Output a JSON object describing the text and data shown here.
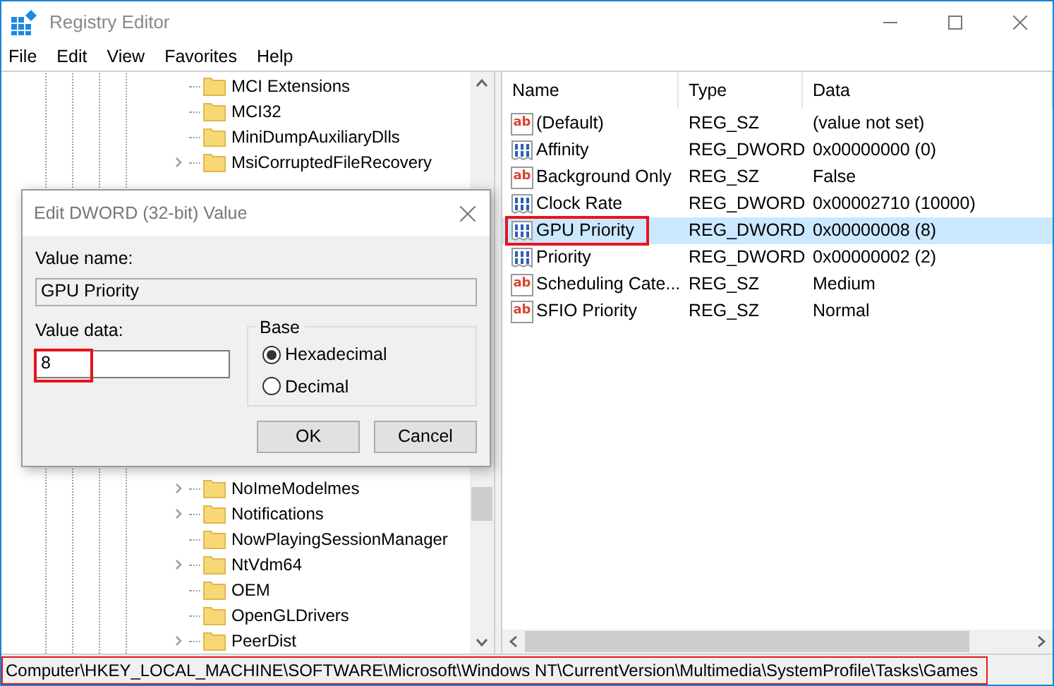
{
  "window": {
    "title": "Registry Editor"
  },
  "menu": [
    "File",
    "Edit",
    "View",
    "Favorites",
    "Help"
  ],
  "tree": {
    "upper": [
      {
        "label": "MCI Extensions",
        "has_children": false
      },
      {
        "label": "MCI32",
        "has_children": false
      },
      {
        "label": "MiniDumpAuxiliaryDlls",
        "has_children": false
      },
      {
        "label": "MsiCorruptedFileRecovery",
        "has_children": true,
        "expanded": false
      }
    ],
    "lower": [
      {
        "label": "NoImeModelmes",
        "has_children": true,
        "expanded": false
      },
      {
        "label": "Notifications",
        "has_children": true,
        "expanded": false
      },
      {
        "label": "NowPlayingSessionManager",
        "has_children": false
      },
      {
        "label": "NtVdm64",
        "has_children": true,
        "expanded": false
      },
      {
        "label": "OEM",
        "has_children": false
      },
      {
        "label": "OpenGLDrivers",
        "has_children": false
      },
      {
        "label": "PeerDist",
        "has_children": true,
        "expanded": false
      }
    ]
  },
  "values": {
    "columns": [
      "Name",
      "Type",
      "Data"
    ],
    "rows": [
      {
        "kind": "sz",
        "icon_label": "ab",
        "name": "(Default)",
        "type": "REG_SZ",
        "data": "(value not set)",
        "selected": false,
        "highlighted": false
      },
      {
        "kind": "dword",
        "name": "Affinity",
        "type": "REG_DWORD",
        "data": "0x00000000 (0)",
        "selected": false,
        "highlighted": false
      },
      {
        "kind": "sz",
        "icon_label": "ab",
        "name": "Background Only",
        "type": "REG_SZ",
        "data": "False",
        "selected": false,
        "highlighted": false
      },
      {
        "kind": "dword",
        "name": "Clock Rate",
        "type": "REG_DWORD",
        "data": "0x00002710 (10000)",
        "selected": false,
        "highlighted": false
      },
      {
        "kind": "dword",
        "name": "GPU Priority",
        "type": "REG_DWORD",
        "data": "0x00000008 (8)",
        "selected": true,
        "highlighted": true
      },
      {
        "kind": "dword",
        "name": "Priority",
        "type": "REG_DWORD",
        "data": "0x00000002 (2)",
        "selected": false,
        "highlighted": false
      },
      {
        "kind": "sz",
        "icon_label": "ab",
        "name": "Scheduling Cate...",
        "type": "REG_SZ",
        "data": "Medium",
        "selected": false,
        "highlighted": false
      },
      {
        "kind": "sz",
        "icon_label": "ab",
        "name": "SFIO Priority",
        "type": "REG_SZ",
        "data": "Normal",
        "selected": false,
        "highlighted": false
      }
    ]
  },
  "dialog": {
    "title": "Edit DWORD (32-bit) Value",
    "value_name_label": "Value name:",
    "value_name": "GPU Priority",
    "value_data_label": "Value data:",
    "value_data": "8",
    "value_data_highlighted": true,
    "base_label": "Base",
    "base_options": [
      {
        "label": "Hexadecimal",
        "selected": true
      },
      {
        "label": "Decimal",
        "selected": false
      }
    ],
    "buttons": [
      "OK",
      "Cancel"
    ]
  },
  "status_bar": {
    "path": "Computer\\HKEY_LOCAL_MACHINE\\SOFTWARE\\Microsoft\\Windows NT\\CurrentVersion\\Multimedia\\SystemProfile\\Tasks\\Games",
    "highlighted": true
  }
}
